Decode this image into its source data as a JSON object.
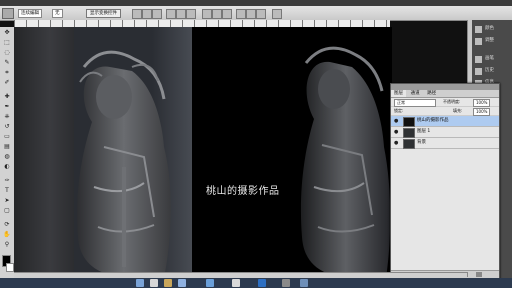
{
  "options_bar": {
    "mode_select": "连续编辑",
    "value_select": "无",
    "button_label": "显示变换控件"
  },
  "document": {
    "watermark_text": "桃山的摄影作品"
  },
  "right_dock": {
    "items": [
      {
        "icon": "swatches-icon",
        "label": "颜色"
      },
      {
        "icon": "adjust-icon",
        "label": "调整"
      },
      {
        "icon": "brush-icon",
        "label": "画笔"
      },
      {
        "icon": "history-icon",
        "label": "历史"
      },
      {
        "icon": "info-icon",
        "label": "信息"
      }
    ]
  },
  "layers_panel": {
    "tabs": [
      "图层",
      "通道",
      "路径"
    ],
    "blend_mode": "正常",
    "opacity_label": "不透明度:",
    "opacity_value": "100%",
    "lock_label": "锁定:",
    "fill_label": "填充:",
    "fill_value": "100%",
    "layers": [
      {
        "name": "桃山的摄影作品",
        "selected": true
      },
      {
        "name": "图层 1",
        "selected": false
      },
      {
        "name": "背景",
        "selected": false
      }
    ]
  },
  "colors": {
    "panel_selected": "#aecbf0",
    "dock_bg": "#4a4a4a",
    "taskbar_bg": "#2c3a4f"
  }
}
